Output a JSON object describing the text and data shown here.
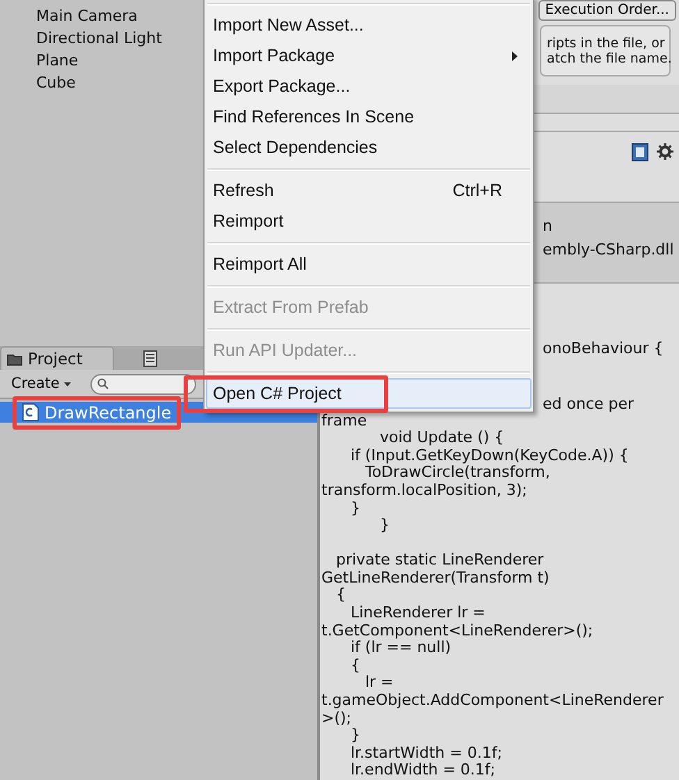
{
  "hierarchy": {
    "items": [
      "Main Camera",
      "Directional Light",
      "Plane",
      "Cube"
    ]
  },
  "project": {
    "tab": "Project",
    "create_button": "Create",
    "assets": [
      {
        "name": "DrawRectangle",
        "selected": true,
        "highlighted": true
      }
    ]
  },
  "inspector": {
    "top_button": "Execution Order...",
    "help_lines": [
      "ripts in the file, or",
      "atch the file name."
    ],
    "info_lines": [
      "n",
      "embly-CSharp.dll"
    ],
    "covered_lines": [
      "onoBehaviour {",
      "ed once per"
    ],
    "code_lines": [
      {
        "kind": "code",
        "text": "frame"
      },
      {
        "kind": "code",
        "text": "            void Update () {"
      },
      {
        "kind": "code",
        "text": "      if (Input.GetKeyDown(KeyCode.A)) {"
      },
      {
        "kind": "code",
        "text": "         ToDrawCircle(transform,"
      },
      {
        "kind": "code",
        "text": "transform.localPosition, 3);"
      },
      {
        "kind": "code",
        "text": "      }"
      },
      {
        "kind": "code",
        "text": "            }"
      },
      {
        "kind": "blank"
      },
      {
        "kind": "code",
        "text": "   private static LineRenderer"
      },
      {
        "kind": "code",
        "text": "GetLineRenderer(Transform t)"
      },
      {
        "kind": "code",
        "text": "   {"
      },
      {
        "kind": "code",
        "text": "      LineRenderer lr ="
      },
      {
        "kind": "code",
        "text": "t.GetComponent<LineRenderer>();"
      },
      {
        "kind": "code",
        "text": "      if (lr == null)"
      },
      {
        "kind": "code",
        "text": "      {"
      },
      {
        "kind": "code",
        "text": "         lr ="
      },
      {
        "kind": "code",
        "text": "t.gameObject.AddComponent<LineRenderer"
      },
      {
        "kind": "code",
        "text": ">();"
      },
      {
        "kind": "code",
        "text": "      }"
      },
      {
        "kind": "code",
        "text": "      lr.startWidth = 0.1f;"
      },
      {
        "kind": "code",
        "text": "      lr.endWidth = 0.1f;"
      }
    ]
  },
  "context_menu": {
    "items": [
      {
        "kind": "separator"
      },
      {
        "kind": "item",
        "label": "Import New Asset...",
        "disabled": false,
        "selected": false,
        "submenu": false,
        "highlighted": false
      },
      {
        "kind": "item",
        "label": "Import Package",
        "disabled": false,
        "selected": false,
        "submenu": true,
        "highlighted": false
      },
      {
        "kind": "item",
        "label": "Export Package...",
        "disabled": false,
        "selected": false,
        "submenu": false,
        "highlighted": false
      },
      {
        "kind": "item",
        "label": "Find References In Scene",
        "disabled": false,
        "selected": false,
        "submenu": false,
        "highlighted": false
      },
      {
        "kind": "item",
        "label": "Select Dependencies",
        "disabled": false,
        "selected": false,
        "submenu": false,
        "highlighted": false
      },
      {
        "kind": "separator"
      },
      {
        "kind": "item",
        "label": "Refresh",
        "shortcut": "Ctrl+R",
        "disabled": false,
        "selected": false,
        "submenu": false,
        "highlighted": false
      },
      {
        "kind": "item",
        "label": "Reimport",
        "disabled": false,
        "selected": false,
        "submenu": false,
        "highlighted": false
      },
      {
        "kind": "separator"
      },
      {
        "kind": "item",
        "label": "Reimport All",
        "disabled": false,
        "selected": false,
        "submenu": false,
        "highlighted": false
      },
      {
        "kind": "separator"
      },
      {
        "kind": "item",
        "label": "Extract From Prefab",
        "disabled": true,
        "selected": false,
        "submenu": false,
        "highlighted": false
      },
      {
        "kind": "separator"
      },
      {
        "kind": "item",
        "label": "Run API Updater...",
        "disabled": true,
        "selected": false,
        "submenu": false,
        "highlighted": false
      },
      {
        "kind": "separator"
      },
      {
        "kind": "item",
        "label": "Open C# Project",
        "disabled": false,
        "selected": true,
        "submenu": false,
        "highlighted": true
      }
    ]
  }
}
